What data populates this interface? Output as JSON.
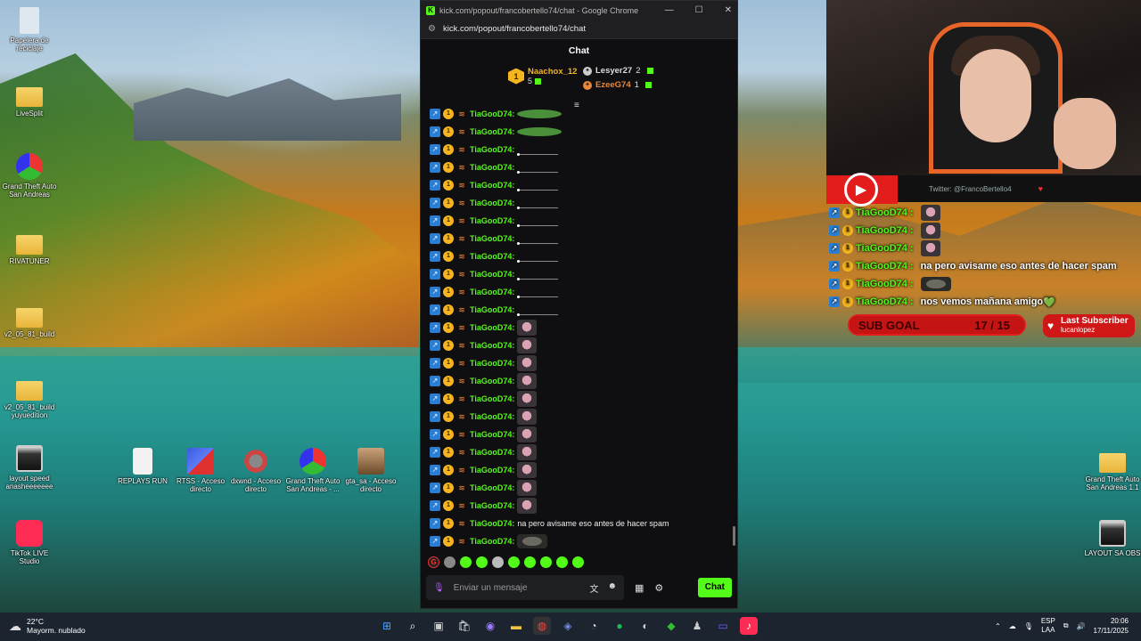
{
  "desktop": {
    "icons": [
      {
        "label": "Papelera de reciclaje",
        "kind": "recycle"
      },
      {
        "label": "LiveSplit",
        "kind": "folder"
      },
      {
        "label": "Grand Theft Auto San Andreas",
        "kind": "gta"
      },
      {
        "label": "RIVATUNER",
        "kind": "folder"
      },
      {
        "label": "v2_05_81_build",
        "kind": "folder"
      },
      {
        "label": "v2_05_81_build yuyuedition",
        "kind": "folder"
      },
      {
        "label": "layout speed anasheeeeeee",
        "kind": "app"
      },
      {
        "label": "TikTok LIVE Studio",
        "kind": "tiktok"
      },
      {
        "label": "REPLAYS RUN",
        "kind": "doc"
      },
      {
        "label": "RTSS - Acceso directo",
        "kind": "rtss"
      },
      {
        "label": "dxwnd - Acceso directo",
        "kind": "dx"
      },
      {
        "label": "Grand Theft Auto San Andreas - ...",
        "kind": "gta"
      },
      {
        "label": "gta_sa - Acceso directo",
        "kind": "photo"
      },
      {
        "label": "Grand Theft Auto San Andreas 1.1",
        "kind": "folder"
      },
      {
        "label": "LAYOUT SA OBS",
        "kind": "app"
      }
    ]
  },
  "browser": {
    "title": "kick.com/popout/francobertello74/chat - Google Chrome",
    "url": "kick.com/popout/francobertello74/chat",
    "controls": [
      "—",
      "☐",
      "✕"
    ]
  },
  "chat": {
    "header": "Chat",
    "leaderboard": {
      "top": {
        "rank": "1",
        "name": "Naachox_12",
        "count": "5"
      },
      "second": {
        "name": "Lesyer27",
        "count": "2"
      },
      "third": {
        "name": "EzeeG74",
        "count": "1"
      }
    },
    "messages": [
      {
        "user": "TiaGooD74:",
        "emote": "frog"
      },
      {
        "user": "TiaGooD74:",
        "emote": "frog"
      },
      {
        "user": "TiaGooD74:",
        "emote": "bar"
      },
      {
        "user": "TiaGooD74:",
        "emote": "bar"
      },
      {
        "user": "TiaGooD74:",
        "emote": "bar"
      },
      {
        "user": "TiaGooD74:",
        "emote": "bar"
      },
      {
        "user": "TiaGooD74:",
        "emote": "bar"
      },
      {
        "user": "TiaGooD74:",
        "emote": "bar"
      },
      {
        "user": "TiaGooD74:",
        "emote": "bar"
      },
      {
        "user": "TiaGooD74:",
        "emote": "bar"
      },
      {
        "user": "TiaGooD74:",
        "emote": "bar"
      },
      {
        "user": "TiaGooD74:",
        "emote": "bar"
      },
      {
        "user": "TiaGooD74:",
        "emote": "pig"
      },
      {
        "user": "TiaGooD74:",
        "emote": "pig"
      },
      {
        "user": "TiaGooD74:",
        "emote": "pig"
      },
      {
        "user": "TiaGooD74:",
        "emote": "pig"
      },
      {
        "user": "TiaGooD74:",
        "emote": "pig"
      },
      {
        "user": "TiaGooD74:",
        "emote": "pig"
      },
      {
        "user": "TiaGooD74:",
        "emote": "pig"
      },
      {
        "user": "TiaGooD74:",
        "emote": "pig"
      },
      {
        "user": "TiaGooD74:",
        "emote": "pig"
      },
      {
        "user": "TiaGooD74:",
        "emote": "pig"
      },
      {
        "user": "TiaGooD74:",
        "emote": "pig"
      },
      {
        "user": "TiaGooD74:",
        "text": "na pero avisame eso antes de hacer spam"
      },
      {
        "user": "TiaGooD74:",
        "emote": "dark"
      },
      {
        "user": "TiaGooD74:",
        "text": "nos vemos mañana amigo",
        "heart": "💚"
      }
    ],
    "input_placeholder": "Enviar un mensaje",
    "send_label": "Chat"
  },
  "overlay": {
    "twitter": "Twitter: @FrancoBertello4",
    "messages": [
      {
        "user": "TiaGooD74 :",
        "emote": "pig"
      },
      {
        "user": "TiaGooD74 :",
        "emote": "pig"
      },
      {
        "user": "TiaGooD74 :",
        "emote": "pig"
      },
      {
        "user": "TiaGooD74 :",
        "text": "na pero avisame eso antes de hacer spam"
      },
      {
        "user": "TiaGooD74 :",
        "emote": "dark"
      },
      {
        "user": "TiaGooD74 :",
        "text": "nos vemos mañana amigo",
        "heart": "💚"
      }
    ],
    "sub_goal": {
      "label": "SUB GOAL",
      "value": "17 / 15",
      "progress": 1.0
    },
    "last_subscriber": {
      "title": "Last Subscriber",
      "name": "lucanlopez"
    }
  },
  "taskbar": {
    "weather": {
      "temp": "22°C",
      "desc": "Mayorm. nublado"
    },
    "lang": {
      "top": "ESP",
      "bottom": "LAA"
    },
    "time": "20:06",
    "date": "17/11/2025"
  }
}
